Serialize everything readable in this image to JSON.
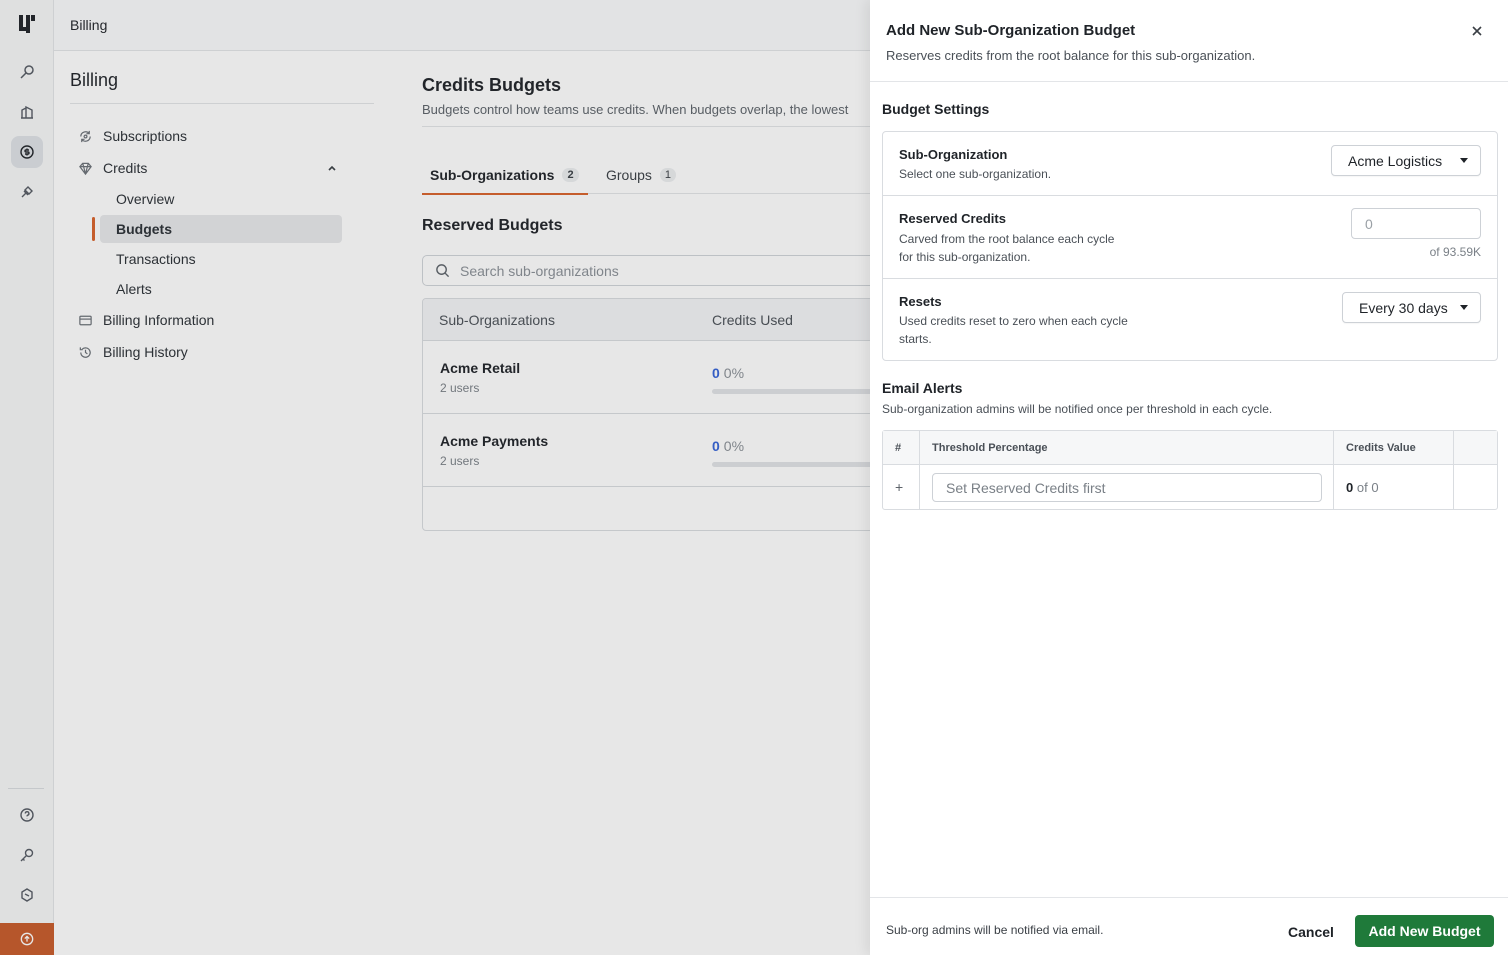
{
  "topbar": {
    "title": "Billing"
  },
  "nav": {
    "heading": "Billing",
    "subscriptions": "Subscriptions",
    "credits": "Credits",
    "credits_sub": [
      "Overview",
      "Budgets",
      "Transactions",
      "Alerts"
    ],
    "billing_information": "Billing Information",
    "billing_history": "Billing History"
  },
  "main": {
    "title": "Credits Budgets",
    "description": "Budgets control how teams use credits. When budgets overlap, the lowest",
    "tabs": [
      {
        "label": "Sub-Organizations",
        "count": "2"
      },
      {
        "label": "Groups",
        "count": "1"
      }
    ],
    "section_title": "Reserved Budgets",
    "search_placeholder": "Search sub-organizations",
    "table": {
      "columns": [
        "Sub-Organizations",
        "Credits Used"
      ],
      "rows": [
        {
          "name": "Acme Retail",
          "users": "2 users",
          "used": "0",
          "percent": "0%",
          "fill": 0
        },
        {
          "name": "Acme Payments",
          "users": "2 users",
          "used": "0",
          "percent": "0%",
          "fill": 0
        }
      ]
    }
  },
  "drawer": {
    "title": "Add New Sub-Organization Budget",
    "subtitle": "Reserves credits from the root balance for this sub-organization.",
    "budget_settings_title": "Budget Settings",
    "sub_org": {
      "label": "Sub-Organization",
      "hint": "Select one sub-organization.",
      "selected": "Acme Logistics"
    },
    "reserved": {
      "label": "Reserved Credits",
      "hint": "Carved from the root balance each cycle for this sub-organization.",
      "value": "0",
      "of": "of 93.59K"
    },
    "resets": {
      "label": "Resets",
      "hint": "Used credits reset to zero when each cycle starts.",
      "selected": "Every 30 days"
    },
    "alerts": {
      "title": "Email Alerts",
      "subtitle": "Sub-organization admins will be notified once per threshold in each cycle.",
      "columns": [
        "#",
        "Threshold Percentage",
        "Credits Value"
      ],
      "add_symbol": "+",
      "threshold_placeholder": "Set Reserved Credits first",
      "credits_value": "0",
      "credits_of": "of 0"
    },
    "footer": {
      "note": "Sub-org admins will be notified via email.",
      "cancel": "Cancel",
      "submit": "Add New Budget"
    }
  },
  "colors": {
    "accent": "#d9622b",
    "primary_button": "#1f7a3a",
    "link_blue": "#3563d8"
  }
}
